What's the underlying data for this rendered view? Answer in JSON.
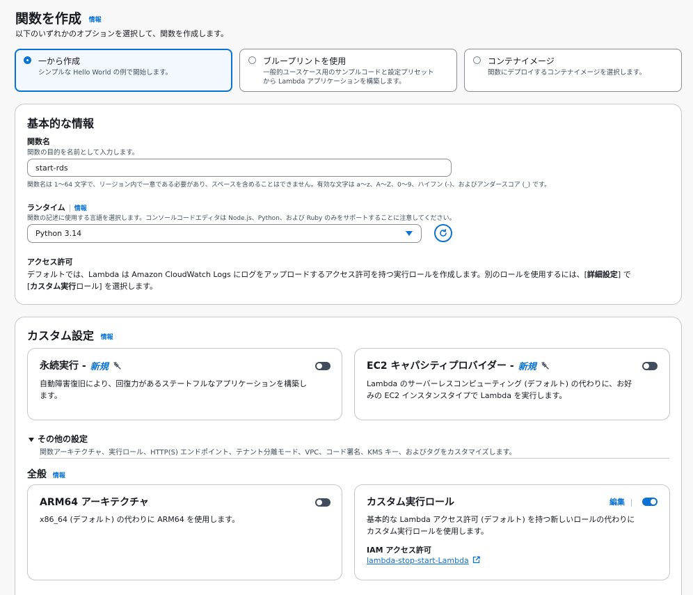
{
  "header": {
    "title": "関数を作成",
    "info": "情報",
    "subtitle": "以下のいずれかのオプションを選択して、関数を作成します。"
  },
  "options": [
    {
      "title": "一から作成",
      "desc1": "シンプルな Hello World の例で開始します。",
      "desc2": "",
      "selected": true
    },
    {
      "title": "ブループリントを使用",
      "desc1": "一般的ユースケース用のサンプルコードと設定プリセット",
      "desc2": "から Lambda アプリケーションを構築します。",
      "selected": false
    },
    {
      "title": "コンテナイメージ",
      "desc1": "関数にデプロイするコンテナイメージを選択します。",
      "desc2": "",
      "selected": false
    }
  ],
  "basic": {
    "title": "基本的な情報",
    "function_name_label": "関数名",
    "function_name_desc": "関数の目的を名前として入力します。",
    "function_name_value": "start-rds",
    "function_name_hint": "関数名は 1〜64 文字で、リージョン内で一意である必要があり、スペースを含めることはできません。有効な文字は a〜z、A〜Z、0〜9、ハイフン (-)、およびアンダースコア (_) です。",
    "runtime_label": "ランタイム",
    "runtime_info": "情報",
    "runtime_desc": "関数の記述に使用する言語を選択します。コンソールコードエディタは Node.js、Python、および Ruby のみをサポートすることに注意してください。",
    "runtime_value": "Python 3.14",
    "access_label": "アクセス許可",
    "access_text1_a": "デフォルトでは、Lambda は Amazon CloudWatch Logs にログをアップロードするアクセス許可を持つ実行ロールを作成します。別のロールを使用するには、[",
    "access_text1_b": "詳細設定",
    "access_text1_c": "] で",
    "access_text2_a": "[",
    "access_text2_b": "カスタム実行",
    "access_text2_c": "ロール] を選択します。"
  },
  "custom": {
    "title": "カスタム設定",
    "info": "情報",
    "durable": {
      "title": "永続実行 -",
      "badge": "新規",
      "desc1": "自動障害復旧により、回復力があるステートフルなアプリケーションを構築し",
      "desc2": "ます。"
    },
    "ec2": {
      "title": "EC2 キャパシティプロバイダー -",
      "badge": "新規",
      "desc1": "Lambda のサーバーレスコンピューティング (デフォルト) の代わりに、お好",
      "desc2": "みの EC2 インスタンスタイプで Lambda を実行します。"
    },
    "other_title": "その他の設定",
    "other_desc": "関数アーキテクチャ、実行ロール、HTTP(S) エンドポイント、テナント分離モード、VPC、コード署名、KMS キー、およびタグをカスタマイズします。",
    "general_title": "全般",
    "general_info": "情報",
    "arm": {
      "title": "ARM64 アーキテクチャ",
      "desc": "x86_64 (デフォルト) の代わりに ARM64 を使用します。"
    },
    "role": {
      "title": "カスタム実行ロール",
      "edit": "編集",
      "desc1": "基本的な Lambda アクセス許可 (デフォルト) を持つ新しいロールの代わりに",
      "desc2": "カスタム実行ロールを使用します。",
      "iam_label": "IAM アクセス許可",
      "iam_link": "lambda-stop-start-Lambda"
    }
  }
}
